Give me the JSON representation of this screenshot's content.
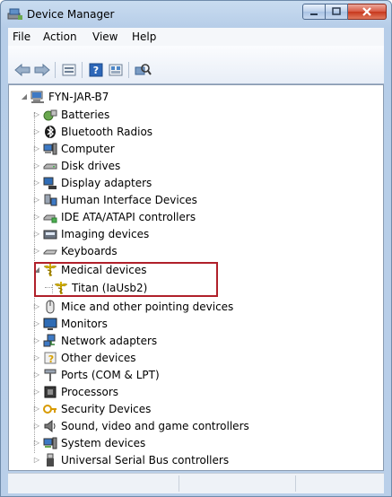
{
  "window": {
    "title": "Device Manager"
  },
  "menu": [
    "File",
    "Action",
    "View",
    "Help"
  ],
  "toolbar": {
    "buttons": [
      "back-arrow-icon",
      "forward-arrow-icon",
      "properties-icon",
      "help-icon",
      "view-icon",
      "scan-hardware-icon"
    ]
  },
  "tree": {
    "root": "FYN-JAR-B7",
    "items": [
      {
        "label": "Batteries",
        "icon": "battery-icon"
      },
      {
        "label": "Bluetooth Radios",
        "icon": "bluetooth-icon"
      },
      {
        "label": "Computer",
        "icon": "computer-icon"
      },
      {
        "label": "Disk drives",
        "icon": "disk-drive-icon"
      },
      {
        "label": "Display adapters",
        "icon": "display-adapter-icon"
      },
      {
        "label": "Human Interface Devices",
        "icon": "hid-icon"
      },
      {
        "label": "IDE ATA/ATAPI controllers",
        "icon": "ide-controller-icon"
      },
      {
        "label": "Imaging devices",
        "icon": "imaging-device-icon"
      },
      {
        "label": "Keyboards",
        "icon": "keyboard-icon"
      },
      {
        "label": "Medical devices",
        "icon": "caduceus-icon",
        "expanded": true,
        "children": [
          {
            "label": "Titan (IaUsb2)",
            "icon": "caduceus-icon"
          }
        ]
      },
      {
        "label": "Mice and other pointing devices",
        "icon": "mouse-icon"
      },
      {
        "label": "Monitors",
        "icon": "monitor-icon"
      },
      {
        "label": "Network adapters",
        "icon": "network-adapter-icon"
      },
      {
        "label": "Other devices",
        "icon": "unknown-device-icon"
      },
      {
        "label": "Ports (COM & LPT)",
        "icon": "port-icon"
      },
      {
        "label": "Processors",
        "icon": "processor-icon"
      },
      {
        "label": "Security Devices",
        "icon": "security-device-icon"
      },
      {
        "label": "Sound, video and game controllers",
        "icon": "speaker-icon"
      },
      {
        "label": "System devices",
        "icon": "system-device-icon"
      },
      {
        "label": "Universal Serial Bus controllers",
        "icon": "usb-icon"
      }
    ]
  },
  "colors": {
    "highlight_border": "#b0202a",
    "caduceus": "#d8b400"
  }
}
